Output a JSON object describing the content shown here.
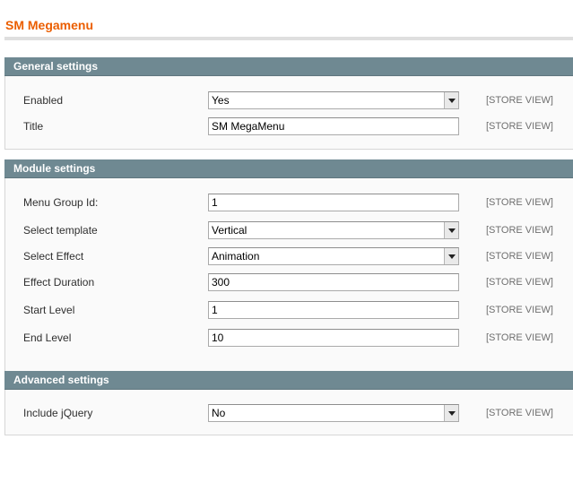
{
  "page": {
    "title": "SM Megamenu"
  },
  "sections": {
    "general": {
      "title": "General settings",
      "rows": [
        {
          "label": "Enabled",
          "value": "Yes",
          "scope": "[STORE VIEW]"
        },
        {
          "label": "Title",
          "value": "SM MegaMenu",
          "scope": "[STORE VIEW]"
        }
      ]
    },
    "module": {
      "title": "Module settings",
      "rows": [
        {
          "label": "Menu Group Id:",
          "value": "1",
          "scope": "[STORE VIEW]"
        },
        {
          "label": "Select template",
          "value": "Vertical",
          "scope": "[STORE VIEW]"
        },
        {
          "label": "Select Effect",
          "value": "Animation",
          "scope": "[STORE VIEW]"
        },
        {
          "label": "Effect Duration",
          "value": "300",
          "scope": "[STORE VIEW]"
        },
        {
          "label": "Start Level",
          "value": "1",
          "scope": "[STORE VIEW]"
        },
        {
          "label": "End Level",
          "value": "10",
          "scope": "[STORE VIEW]"
        }
      ]
    },
    "advanced": {
      "title": "Advanced settings",
      "rows": [
        {
          "label": "Include jQuery",
          "value": "No",
          "scope": "[STORE VIEW]"
        }
      ]
    }
  },
  "colors": {
    "title": "#eb5e00",
    "section_header_bg": "#6f8992",
    "section_header_text": "#ffffff",
    "scope_text": "#6f6f6f"
  },
  "icons": {
    "dropdown": "chevron-down-icon"
  }
}
